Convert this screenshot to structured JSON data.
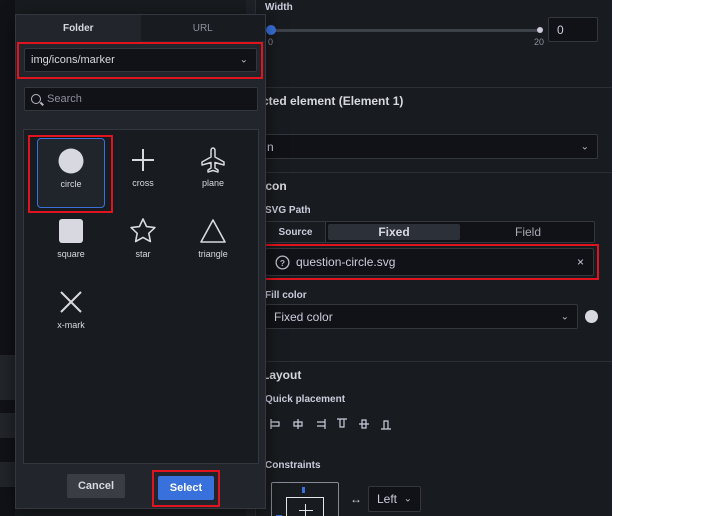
{
  "colors": {
    "accent": "#3871dc",
    "highlight": "#e0141e",
    "panel": "#181b1f",
    "modal": "#22252b"
  },
  "width_control": {
    "label": "Width",
    "min_tick": "0",
    "max_tick": "20",
    "value": "0",
    "fill_fraction": 0.0
  },
  "selected_element": {
    "title": "cted element (Element 1)",
    "select_value": "n"
  },
  "icon_section": {
    "title": "Icon",
    "svg_path_label": "SVG Path",
    "source_label": "Source",
    "source_options": [
      "Fixed",
      "Field"
    ],
    "source_active": "Fixed",
    "file_value": "question-circle.svg",
    "file_icon": "question-circle-icon",
    "clear_glyph": "×",
    "fill_color_label": "Fill color",
    "fill_color_value": "Fixed color"
  },
  "layout_section": {
    "title": "Layout",
    "quick_placement_label": "Quick placement",
    "constraints_label": "Constraints",
    "constraint_value": "Left",
    "arrow_glyph": "↔"
  },
  "picker": {
    "tabs": [
      "Folder",
      "URL"
    ],
    "active_tab": "Folder",
    "folder_value": "img/icons/marker",
    "search_placeholder": "Search",
    "icons": [
      {
        "name": "circle",
        "icon": "circle-icon",
        "selected": true
      },
      {
        "name": "cross",
        "icon": "cross-icon",
        "selected": false
      },
      {
        "name": "plane",
        "icon": "plane-icon",
        "selected": false
      },
      {
        "name": "square",
        "icon": "square-icon",
        "selected": false
      },
      {
        "name": "star",
        "icon": "star-icon",
        "selected": false
      },
      {
        "name": "triangle",
        "icon": "triangle-icon",
        "selected": false
      },
      {
        "name": "x-mark",
        "icon": "x-mark-icon",
        "selected": false
      }
    ],
    "cancel_label": "Cancel",
    "select_label": "Select"
  }
}
